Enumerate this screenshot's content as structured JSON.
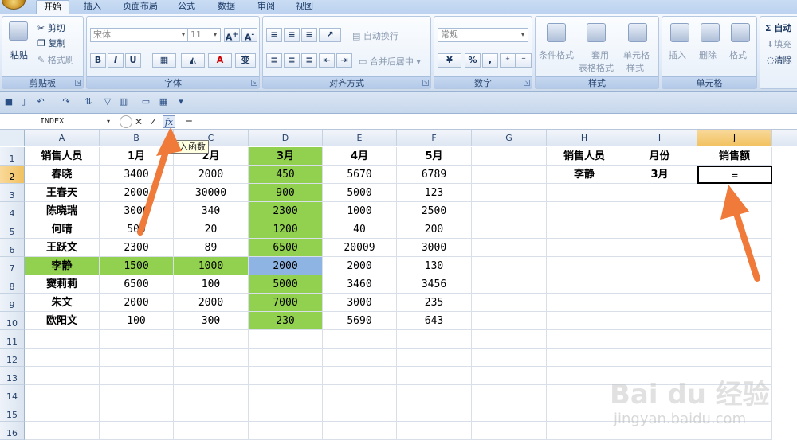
{
  "tabs": [
    "开始",
    "插入",
    "页面布局",
    "公式",
    "数据",
    "审阅",
    "视图"
  ],
  "ribbon": {
    "clipboard": {
      "label": "剪贴板",
      "paste": "粘贴",
      "cut": "剪切",
      "copy": "复制",
      "format_painter": "格式刷"
    },
    "font": {
      "label": "字体",
      "font_name": "宋体",
      "font_size": "11",
      "bold": "B",
      "italic": "I",
      "underline": "U",
      "phonetic": "变"
    },
    "alignment": {
      "label": "对齐方式",
      "wrap_text": "自动换行",
      "merge_center": "合并后居中"
    },
    "number": {
      "label": "数字",
      "format": "常规",
      "percent": "%"
    },
    "styles": {
      "label": "样式",
      "conditional": "条件格式",
      "table_format_1": "套用",
      "table_format_2": "表格格式",
      "cell_styles_1": "单元格",
      "cell_styles_2": "样式"
    },
    "cells": {
      "label": "单元格",
      "insert": "插入",
      "delete": "删除",
      "format": "格式"
    },
    "editing": {
      "autosum": "Σ 自动",
      "fill": "填充",
      "clear": "清除"
    }
  },
  "formula_bar": {
    "name_box": "INDEX",
    "formula": "=",
    "cancel": "✕",
    "enter": "✓",
    "insert_fn": "fx",
    "tooltip": "插入函数"
  },
  "columns": [
    "A",
    "B",
    "C",
    "D",
    "E",
    "F",
    "G",
    "H",
    "I",
    "J"
  ],
  "rows": [
    "1",
    "2",
    "3",
    "4",
    "5",
    "6",
    "7",
    "8",
    "9",
    "10",
    "11",
    "12",
    "13",
    "14",
    "15",
    "16"
  ],
  "table": {
    "header": [
      "销售人员",
      "1月",
      "2月",
      "3月",
      "4月",
      "5月"
    ],
    "data": [
      [
        "春晓",
        "3400",
        "2000",
        "450",
        "5670",
        "6789"
      ],
      [
        "王春天",
        "2000",
        "30000",
        "900",
        "5000",
        "123"
      ],
      [
        "陈晓瑞",
        "3000",
        "340",
        "2300",
        "1000",
        "2500"
      ],
      [
        "何晴",
        "500",
        "20",
        "1200",
        "40",
        "200"
      ],
      [
        "王跃文",
        "2300",
        "89",
        "6500",
        "20009",
        "3000"
      ],
      [
        "李静",
        "1500",
        "1000",
        "2000",
        "2000",
        "130"
      ],
      [
        "窦莉莉",
        "6500",
        "100",
        "5000",
        "3460",
        "3456"
      ],
      [
        "朱文",
        "2000",
        "2000",
        "7000",
        "3000",
        "235"
      ],
      [
        "欧阳文",
        "100",
        "300",
        "230",
        "5690",
        "643"
      ]
    ]
  },
  "lookup": {
    "header": [
      "销售人员",
      "月份",
      "销售额"
    ],
    "values": [
      "李静",
      "3月",
      "="
    ]
  },
  "colors": {
    "highlight_green": "#92d050",
    "highlight_blue": "#8eb4e3",
    "arrow": "#f07a3a"
  },
  "watermark": {
    "brand": "Bai du 经验",
    "url": "jingyan.baidu.com"
  }
}
